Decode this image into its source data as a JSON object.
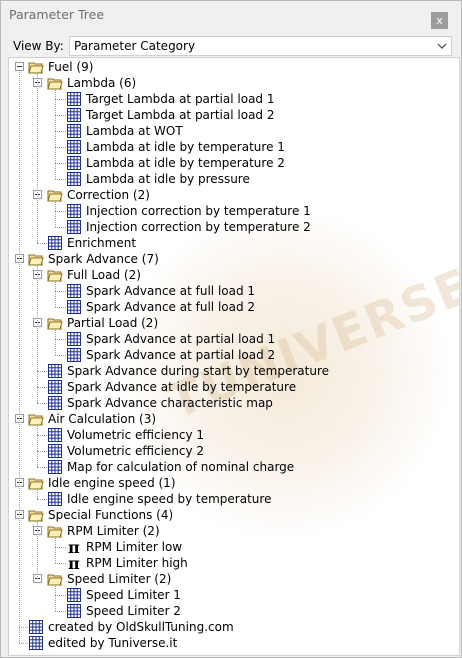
{
  "panel_title": "Parameter Tree",
  "close_label": "x",
  "view_by": {
    "label": "View By:",
    "selected": "Parameter Category"
  },
  "watermark": "TUNIVERSE",
  "tree": [
    {
      "label": "Fuel (9)",
      "level": 0,
      "kind": "folder"
    },
    {
      "label": "Lambda (6)",
      "level": 1,
      "kind": "folder"
    },
    {
      "label": "Target Lambda at partial load 1",
      "level": 2,
      "kind": "table"
    },
    {
      "label": "Target Lambda at partial load 2",
      "level": 2,
      "kind": "table"
    },
    {
      "label": "Lambda at WOT",
      "level": 2,
      "kind": "table"
    },
    {
      "label": "Lambda at idle by temperature 1",
      "level": 2,
      "kind": "table"
    },
    {
      "label": "Lambda at idle by temperature 2",
      "level": 2,
      "kind": "table"
    },
    {
      "label": "Lambda at idle by pressure",
      "level": 2,
      "kind": "table"
    },
    {
      "label": "Correction (2)",
      "level": 1,
      "kind": "folder"
    },
    {
      "label": "Injection correction by temperature 1",
      "level": 2,
      "kind": "table"
    },
    {
      "label": "Injection correction by temperature 2",
      "level": 2,
      "kind": "table"
    },
    {
      "label": "Enrichment",
      "level": 1,
      "kind": "table"
    },
    {
      "label": "Spark Advance (7)",
      "level": 0,
      "kind": "folder"
    },
    {
      "label": "Full Load (2)",
      "level": 1,
      "kind": "folder"
    },
    {
      "label": "Spark Advance at full load 1",
      "level": 2,
      "kind": "table"
    },
    {
      "label": "Spark Advance at full load 2",
      "level": 2,
      "kind": "table"
    },
    {
      "label": "Partial Load (2)",
      "level": 1,
      "kind": "folder"
    },
    {
      "label": "Spark Advance at partial load 1",
      "level": 2,
      "kind": "table"
    },
    {
      "label": "Spark Advance at partial load 2",
      "level": 2,
      "kind": "table"
    },
    {
      "label": "Spark Advance during start by temperature",
      "level": 1,
      "kind": "table"
    },
    {
      "label": "Spark Advance at idle by temperature",
      "level": 1,
      "kind": "table"
    },
    {
      "label": "Spark Advance characteristic map",
      "level": 1,
      "kind": "table"
    },
    {
      "label": "Air Calculation (3)",
      "level": 0,
      "kind": "folder"
    },
    {
      "label": "Volumetric efficiency 1",
      "level": 1,
      "kind": "table"
    },
    {
      "label": "Volumetric efficiency 2",
      "level": 1,
      "kind": "table"
    },
    {
      "label": "Map for calculation of nominal charge",
      "level": 1,
      "kind": "table"
    },
    {
      "label": "Idle engine speed (1)",
      "level": 0,
      "kind": "folder"
    },
    {
      "label": "Idle engine speed by temperature",
      "level": 1,
      "kind": "table"
    },
    {
      "label": "Special Functions (4)",
      "level": 0,
      "kind": "folder"
    },
    {
      "label": "RPM Limiter (2)",
      "level": 1,
      "kind": "folder"
    },
    {
      "label": "RPM Limiter low",
      "level": 2,
      "kind": "pi"
    },
    {
      "label": "RPM Limiter high",
      "level": 2,
      "kind": "pi"
    },
    {
      "label": "Speed Limiter (2)",
      "level": 1,
      "kind": "folder"
    },
    {
      "label": "Speed Limiter 1",
      "level": 2,
      "kind": "table"
    },
    {
      "label": "Speed Limiter 2",
      "level": 2,
      "kind": "table"
    },
    {
      "label": "created by OldSkullTuning.com",
      "level": 0,
      "kind": "table"
    },
    {
      "label": "edited by Tuniverse.it",
      "level": 0,
      "kind": "table"
    }
  ]
}
